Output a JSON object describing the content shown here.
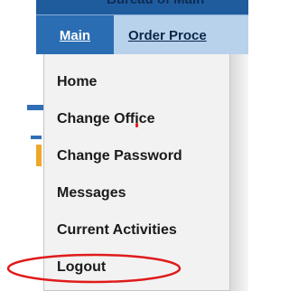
{
  "header": {
    "partial_title": "Bureau of Main"
  },
  "menubar": {
    "main_label": "Main",
    "order_label": "Order Proce"
  },
  "dropdown": {
    "items": [
      {
        "label": "Home"
      },
      {
        "label": "Change Office"
      },
      {
        "label": "Change Password"
      },
      {
        "label": "Messages"
      },
      {
        "label": "Current Activities"
      },
      {
        "label": "Logout"
      }
    ]
  },
  "annotation": {
    "color": "#e01b1b"
  }
}
